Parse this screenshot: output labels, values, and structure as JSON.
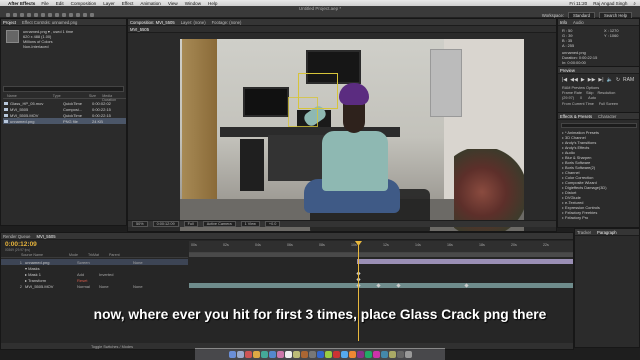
{
  "menubar": {
    "app_name": "After Effects",
    "items": [
      "File",
      "Edit",
      "Composition",
      "Layer",
      "Effect",
      "Animation",
      "View",
      "Window",
      "Help"
    ],
    "user": "Raj Angad Singh",
    "clock": "Fri 11:20"
  },
  "toolbar": {
    "title": "Untitled Project.aep *",
    "workspace_label": "Workspace:",
    "workspace_value": "Standard",
    "search_placeholder": "Search Help"
  },
  "project": {
    "tabs": [
      "Project",
      "Effect Controls: unnamed.png"
    ],
    "selected_name": "unnamed.png ▾ , used 1 time",
    "selected_size": "620 x 488 (1.00)",
    "selected_colors": "Millions of Colors",
    "selected_interlace": "Non-Interlaced",
    "columns": [
      "Name",
      "Type",
      "Size",
      "Media Duration"
    ],
    "items": [
      {
        "name": "Glass_HP_05.mov",
        "type": "QuickTime",
        "size": "",
        "duration": "0:00:02:02"
      },
      {
        "name": "MVI_5505",
        "type": "Composi...",
        "size": "",
        "duration": "0:00:22:15"
      },
      {
        "name": "MVI_5505.MOV",
        "type": "QuickTime",
        "size": "2.2 MB",
        "duration": "0:00:22:15"
      },
      {
        "name": "unnamed.png",
        "type": "PNG file",
        "size": "24 KB",
        "duration": ""
      }
    ]
  },
  "composition": {
    "tabs": [
      "Composition: MVI_5505",
      "Layer: (none)",
      "Footage: (none)"
    ],
    "comp_tab": "MVI_5505",
    "viewer_bar": [
      "50%",
      "0:00:12:09",
      "Full",
      "Active Camera",
      "1 View",
      "+0.0"
    ]
  },
  "info": {
    "tabs": [
      "Info",
      "Audio"
    ],
    "lines": [
      "R : 50",
      "G : 39",
      "B : 35",
      "A : 255"
    ],
    "coords": [
      "X : 1270",
      "Y : 1060"
    ],
    "file": "unnamed.png",
    "duration": "Duration: 0:00:22:15",
    "in": "In: 0:00:00:00",
    "out": "Out: 0:00:22:14"
  },
  "preview": {
    "tab": "Preview",
    "transport": [
      "|◀",
      "◀◀",
      "▶",
      "▶▶",
      "▶|",
      "🔈",
      "↻",
      "RAM"
    ],
    "options_label": "RAM Preview Options",
    "row1": [
      "Frame Rate",
      "Skip",
      "Resolution"
    ],
    "row2": [
      "(29.97)",
      "0",
      "Auto"
    ],
    "from_label": "From Current Time",
    "full_screen": "Full Screen"
  },
  "effects": {
    "tabs": [
      "Effects & Presets",
      "Character"
    ],
    "items": [
      "* Animation Presets",
      "3D Channel",
      "Andy's Transitions",
      "Andy's Effects",
      "Audio",
      "Blur & Sharpen",
      "Boris Software",
      "Boris Software(2)",
      "Channel",
      "Color Correction",
      "Composite Wizard",
      "Digieffects Damage(3D)",
      "Distort",
      "DVGlude",
      "e-Textured",
      "Expression Controls",
      "Fxfactory Freebies",
      "Fxfactory Pro"
    ]
  },
  "timeline": {
    "tabs": [
      "Render Queue",
      "MVI_5505"
    ],
    "timecode": "0:00:12:09",
    "timecode_sub": "00369 (29.97 fps)",
    "columns": [
      "Source Name",
      "Mode",
      "TrkMat",
      "Parent"
    ],
    "layers": [
      {
        "num": "1",
        "name": "unnamed.png",
        "mode": "Screen",
        "trkmat": "",
        "parent": "None",
        "sel": true
      },
      {
        "num": "",
        "name": "▾ Masks",
        "mode": "",
        "trkmat": "",
        "parent": "",
        "sel": false
      },
      {
        "num": "",
        "name": "▸ Mask 1",
        "mode": "Add",
        "trkmat": "Inverted",
        "parent": "",
        "sel": false
      },
      {
        "num": "",
        "name": "▸ Transform",
        "mode": "Reset",
        "trkmat": "",
        "parent": "",
        "sel": false
      },
      {
        "num": "2",
        "name": "MVI_5505.MOV",
        "mode": "Normal",
        "trkmat": "None",
        "parent": "None",
        "sel": false
      }
    ],
    "ruler_ticks": [
      "00s",
      "02s",
      "04s",
      "06s",
      "08s",
      "10s",
      "12s",
      "14s",
      "16s",
      "18s",
      "20s",
      "22s"
    ],
    "footer": "Toggle Switches / Modes"
  },
  "paragraph": {
    "tabs": [
      "Tracker",
      "Paragraph"
    ]
  },
  "caption": "now, where ever you hit for first 3 times, place Glass Crack png there"
}
